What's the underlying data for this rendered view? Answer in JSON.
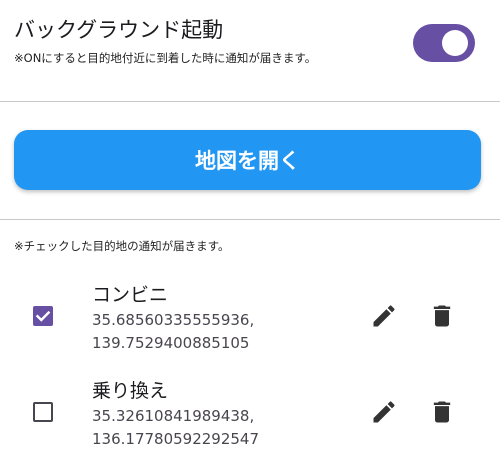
{
  "background": {
    "title": "バックグラウンド起動",
    "description": "※ONにすると目的地付近に到着した時に通知が届きます。",
    "toggle_on": true
  },
  "open_map_button": {
    "label": "地図を開く"
  },
  "list_note": "※チェックした目的地の通知が届きます。",
  "destinations": [
    {
      "name": "コンビニ",
      "latitude": "35.68560335555936,",
      "longitude": "139.7529400885105",
      "checked": true
    },
    {
      "name": "乗り換え",
      "latitude": "35.32610841989438,",
      "longitude": "136.17780592292547",
      "checked": false
    }
  ],
  "colors": {
    "accent": "#6750a4",
    "button": "#2196f3",
    "divider": "#c9c9c9"
  },
  "icons": {
    "edit": "pencil-icon",
    "delete": "trash-icon",
    "check": "check-icon"
  }
}
